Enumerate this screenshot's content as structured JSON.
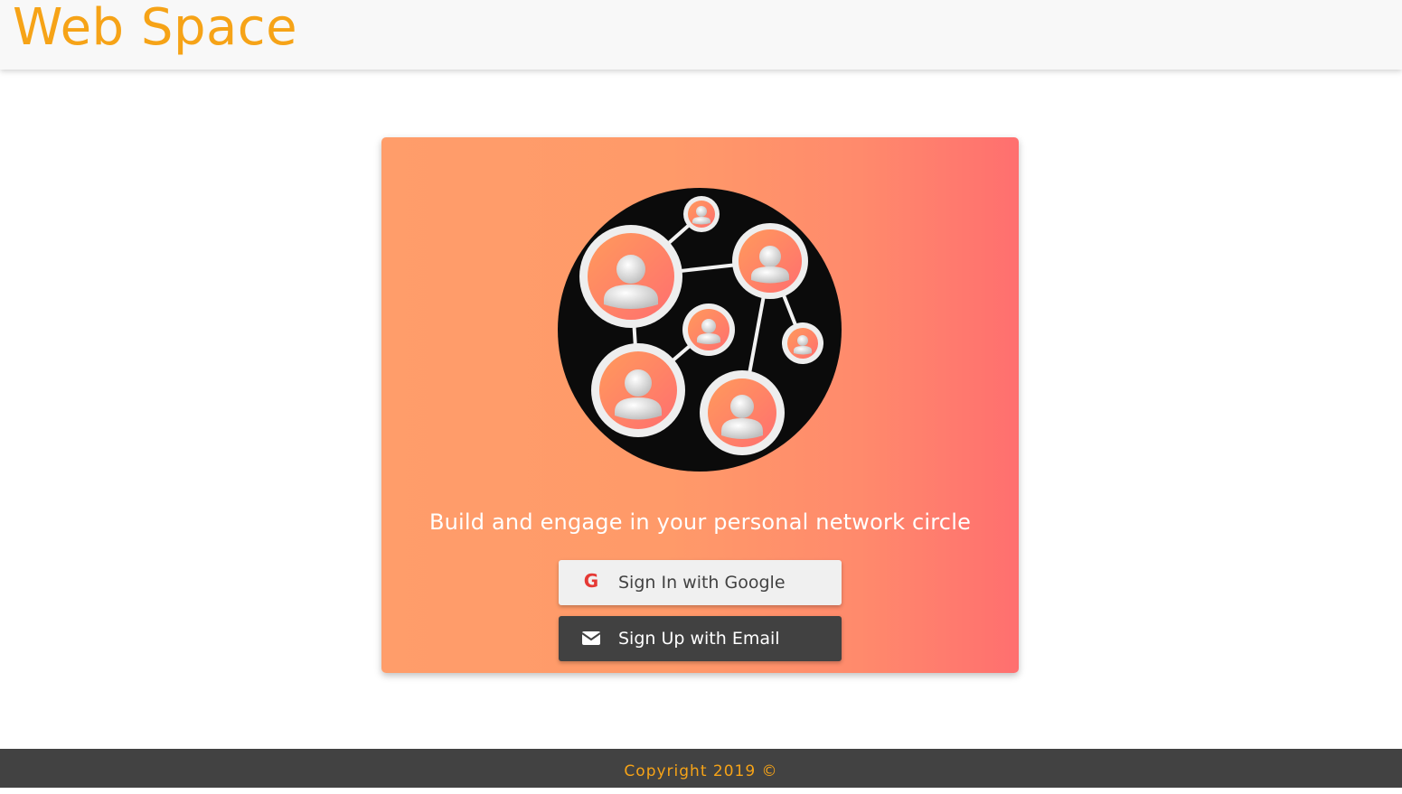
{
  "header": {
    "brand": "Web Space"
  },
  "card": {
    "illustration_icon": "network-circle-illustration",
    "tagline": "Build and engage in your personal network circle",
    "google_button": {
      "label": "Sign In with Google",
      "icon": "google-icon",
      "color": "#e53935"
    },
    "email_button": {
      "label": "Sign Up with Email",
      "icon": "envelope-icon"
    }
  },
  "footer": {
    "copyright": "Copyright 2019 ©"
  },
  "colors": {
    "brand": "#f6a317",
    "card_gradient_start": "#ff9d6a",
    "card_gradient_end": "#ff6f6f",
    "dark": "#414141"
  }
}
